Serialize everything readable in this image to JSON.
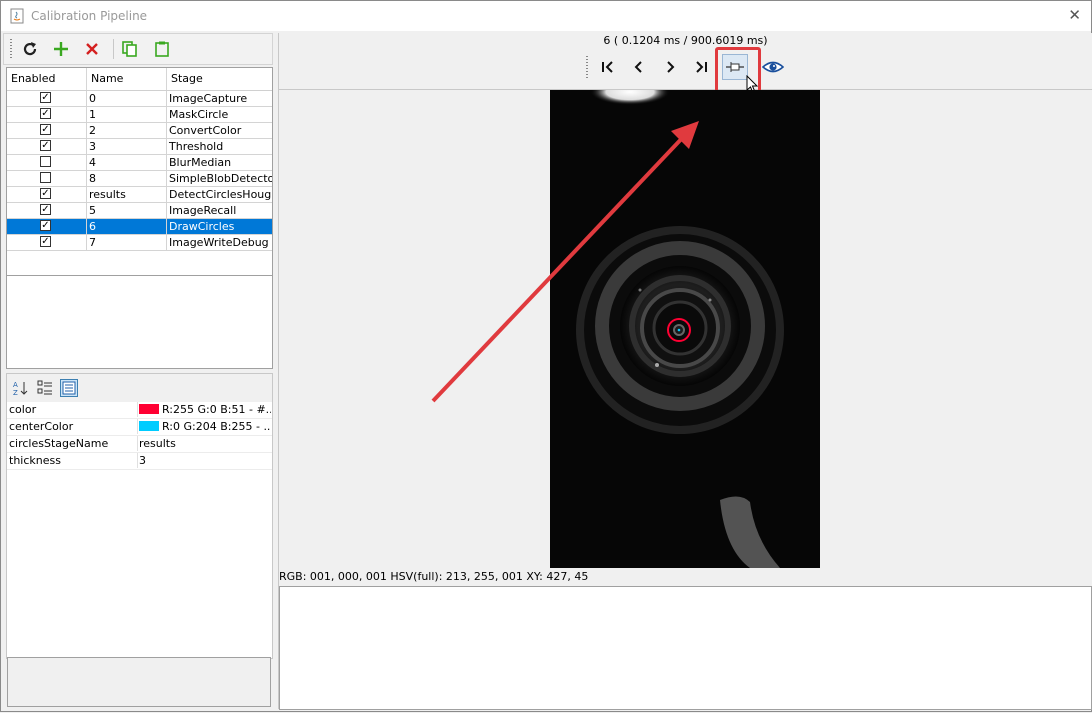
{
  "window": {
    "title": "Calibration Pipeline"
  },
  "toolbar": {
    "refresh_icon": "refresh-icon",
    "add_icon": "add-icon",
    "remove_icon": "remove-icon",
    "copy_icon": "copy-icon",
    "paste_icon": "paste-icon"
  },
  "table": {
    "headers": [
      "Enabled",
      "Name",
      "Stage"
    ],
    "rows": [
      {
        "enabled": true,
        "name": "0",
        "stage": "ImageCapture"
      },
      {
        "enabled": true,
        "name": "1",
        "stage": "MaskCircle"
      },
      {
        "enabled": true,
        "name": "2",
        "stage": "ConvertColor"
      },
      {
        "enabled": true,
        "name": "3",
        "stage": "Threshold"
      },
      {
        "enabled": false,
        "name": "4",
        "stage": "BlurMedian"
      },
      {
        "enabled": false,
        "name": "8",
        "stage": "SimpleBlobDetector"
      },
      {
        "enabled": true,
        "name": "results",
        "stage": "DetectCirclesHough"
      },
      {
        "enabled": true,
        "name": "5",
        "stage": "ImageRecall"
      },
      {
        "enabled": true,
        "name": "6",
        "stage": "DrawCircles",
        "selected": true
      },
      {
        "enabled": true,
        "name": "7",
        "stage": "ImageWriteDebug"
      }
    ]
  },
  "properties": [
    {
      "key": "color",
      "value": "R:255 G:0 B:51 - #...",
      "swatch": "#ff0033"
    },
    {
      "key": "centerColor",
      "value": "R:0 G:204 B:255 - ...",
      "swatch": "#00ccff"
    },
    {
      "key": "circlesStageName",
      "value": "results"
    },
    {
      "key": "thickness",
      "value": "3"
    }
  ],
  "viewer": {
    "frame_info": "6 ( 0.1204 ms / 900.6019 ms)",
    "status_text": "RGB: 001, 000, 001 HSV(full): 213, 255, 001 XY: 427, 45"
  },
  "colors": {
    "selection": "#0078d7",
    "highlight": "#e03a3e",
    "circle": "#ff0033"
  }
}
